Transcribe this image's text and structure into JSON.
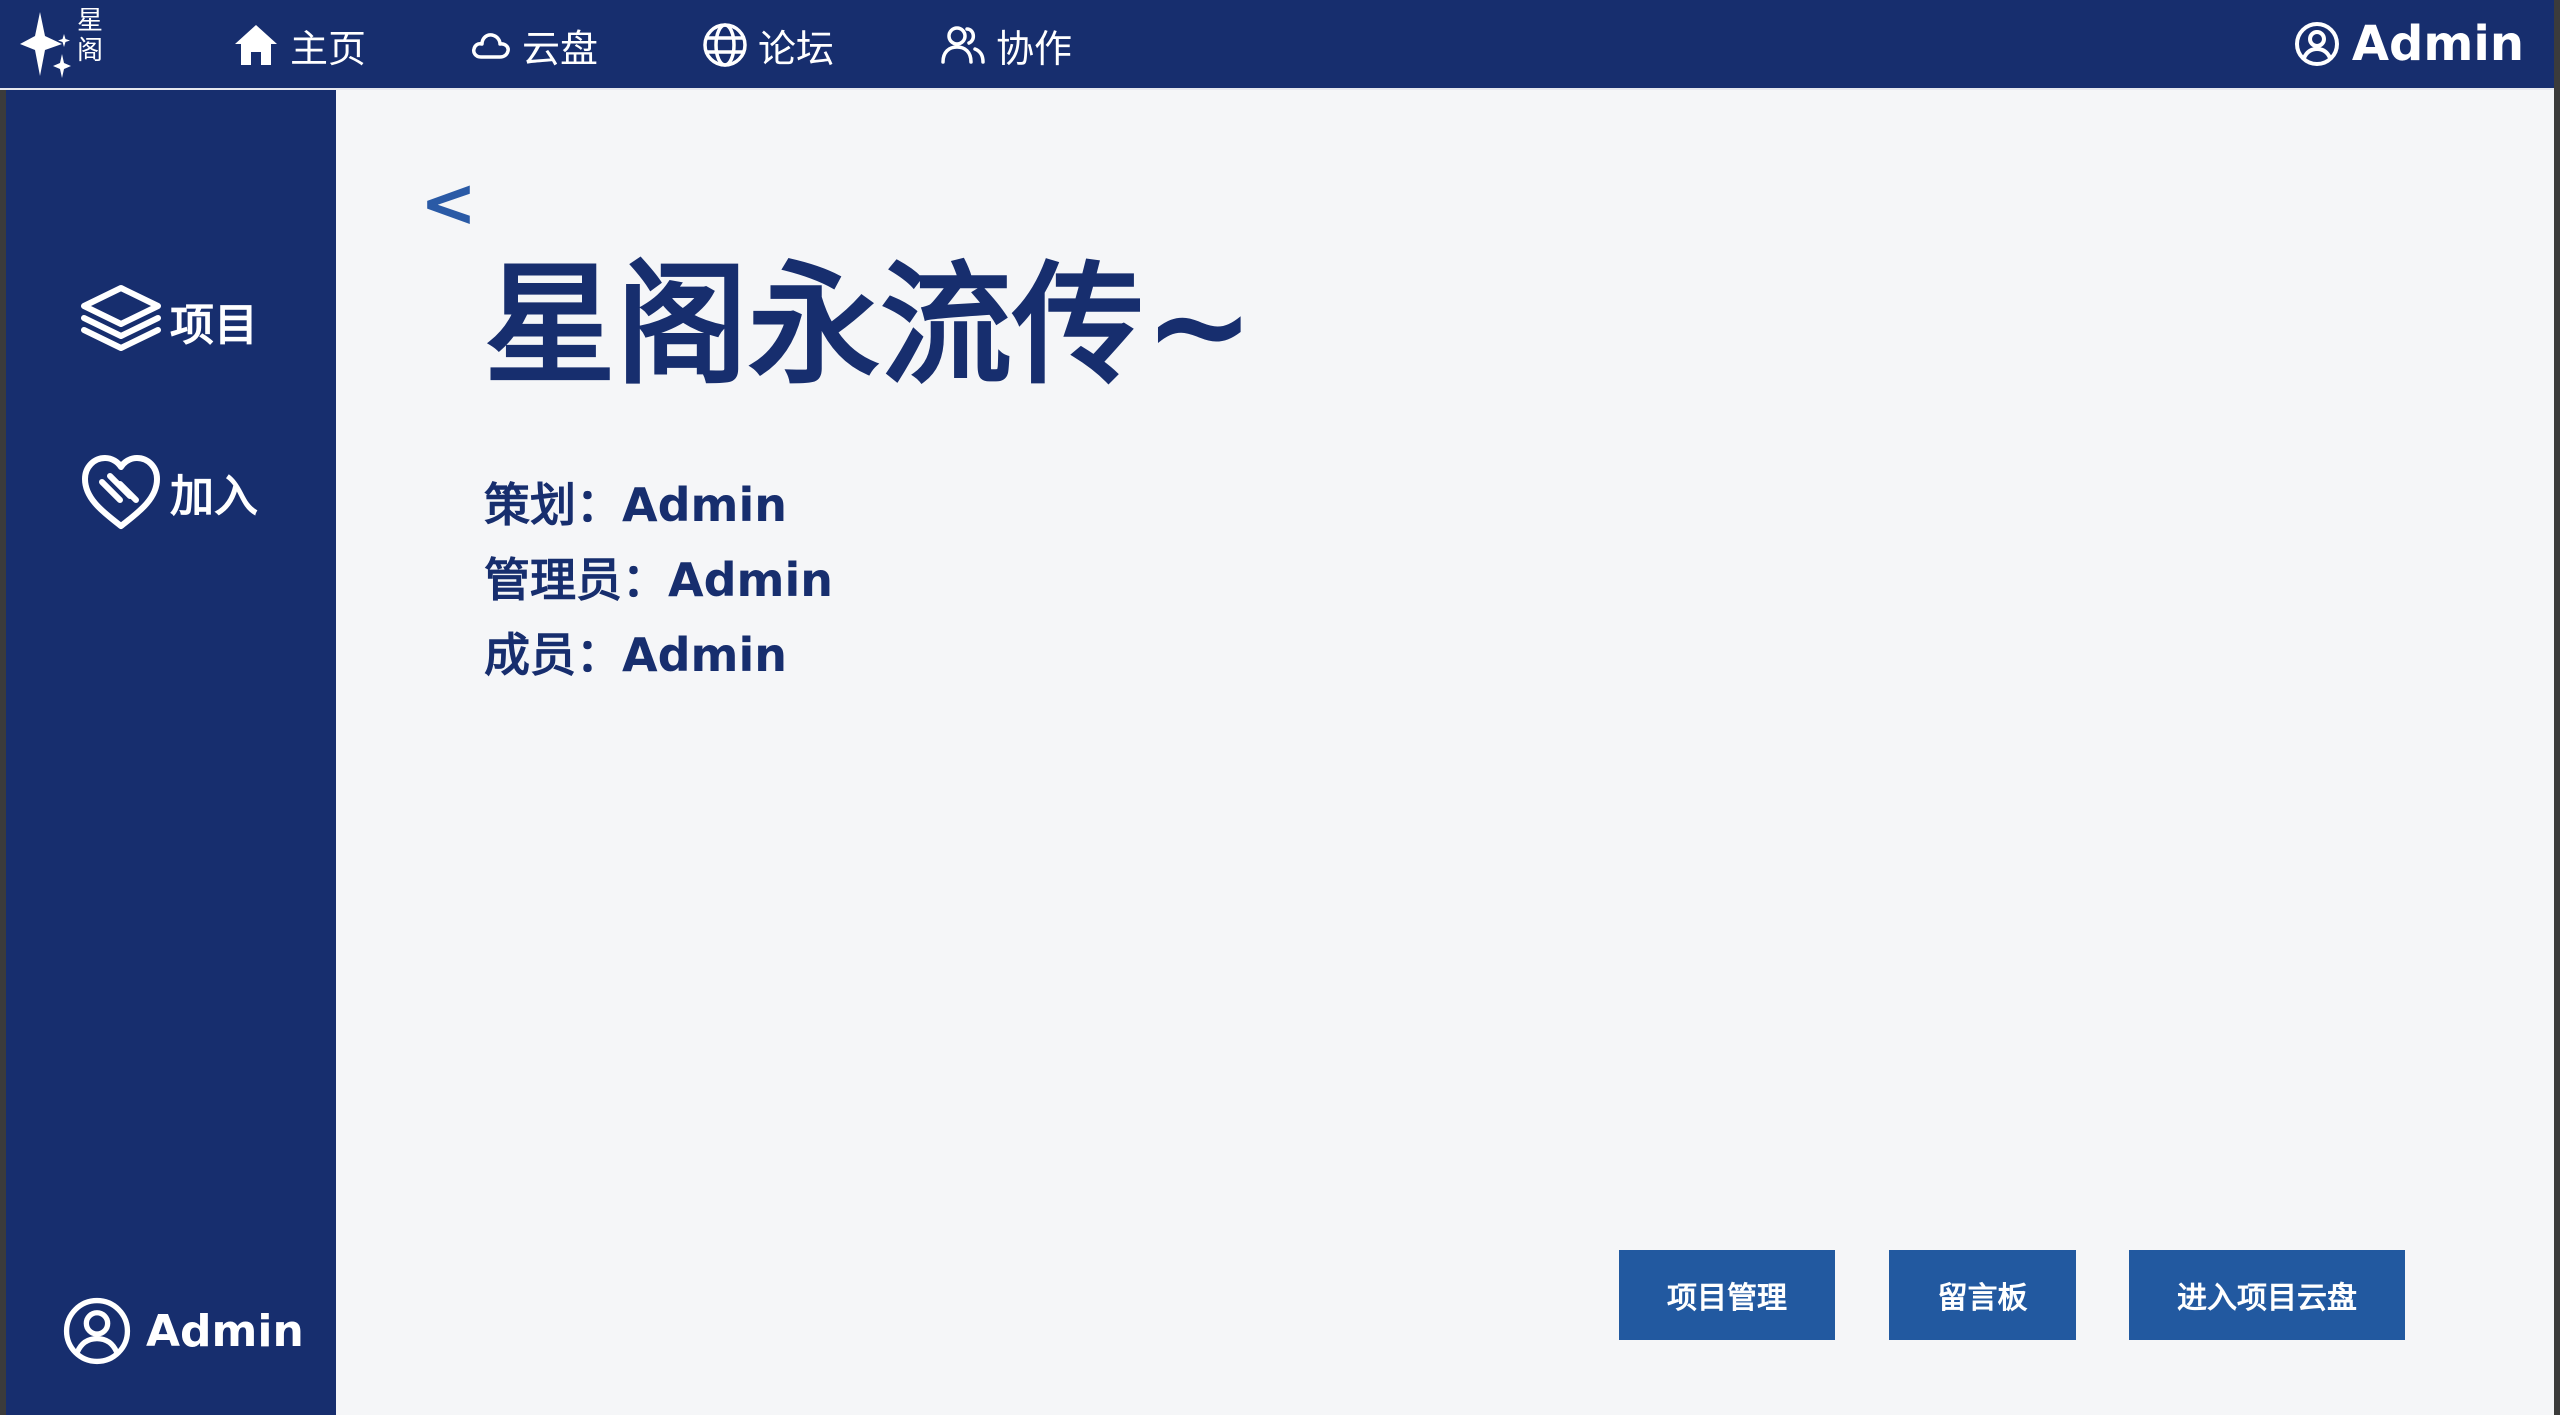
{
  "colors": {
    "navy": "#172e6e",
    "button_blue": "#2259a0",
    "back_blue": "#2a5aa6",
    "content_bg": "#f5f6f8"
  },
  "topbar": {
    "logo": {
      "icon": "sparkle-stars-icon",
      "text": "星阁"
    },
    "nav": [
      {
        "icon": "home-icon",
        "label": "主页"
      },
      {
        "icon": "cloud-icon",
        "label": "云盘"
      },
      {
        "icon": "globe-icon",
        "label": "论坛"
      },
      {
        "icon": "users-icon",
        "label": "协作"
      }
    ],
    "user": {
      "icon": "user-circle-icon",
      "name": "Admin"
    }
  },
  "sidebar": {
    "items": [
      {
        "icon": "layers-icon",
        "label": "项目"
      },
      {
        "icon": "heart-handshake-icon",
        "label": "加入"
      }
    ],
    "user": {
      "icon": "user-circle-icon",
      "name": "Admin"
    }
  },
  "main": {
    "back": "<",
    "title": "星阁永流传~",
    "info": {
      "planner": "策划：Admin",
      "admin": "管理员：Admin",
      "member": "成员：Admin"
    },
    "buttons": {
      "manage": "项目管理",
      "board": "留言板",
      "cloud": "进入项目云盘"
    }
  }
}
